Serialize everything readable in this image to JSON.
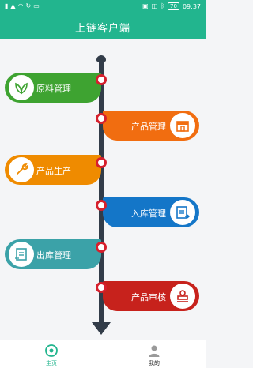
{
  "status_bar": {
    "left_icons": [
      "hd-icon",
      "signal-icon",
      "wifi-icon",
      "sync-icon",
      "message-icon"
    ],
    "battery": "70",
    "time": "09:37"
  },
  "header": {
    "title": "上链客户端"
  },
  "timeline": {
    "items": [
      {
        "label": "原料管理",
        "side": "left",
        "color": "#3ea331",
        "icon": "leaf-icon"
      },
      {
        "label": "产品管理",
        "side": "right",
        "color": "#f16d10",
        "icon": "shop-icon"
      },
      {
        "label": "产品生产",
        "side": "left",
        "color": "#ef8b00",
        "icon": "wrench-icon"
      },
      {
        "label": "入库管理",
        "side": "right",
        "color": "#1476c8",
        "icon": "inbound-form-icon"
      },
      {
        "label": "出库管理",
        "side": "left",
        "color": "#3ba2a8",
        "icon": "outbound-form-icon"
      },
      {
        "label": "产品审核",
        "side": "right",
        "color": "#c7221c",
        "icon": "stamp-icon"
      }
    ]
  },
  "tabbar": {
    "tabs": [
      {
        "label": "主页",
        "icon": "home-icon",
        "active": true,
        "color": "#22b58e"
      },
      {
        "label": "我的",
        "icon": "user-icon",
        "active": false,
        "color": "#333333"
      }
    ]
  },
  "colors": {
    "accent": "#22b58e",
    "timeline": "#323c49",
    "dot_ring": "#d6202d"
  }
}
